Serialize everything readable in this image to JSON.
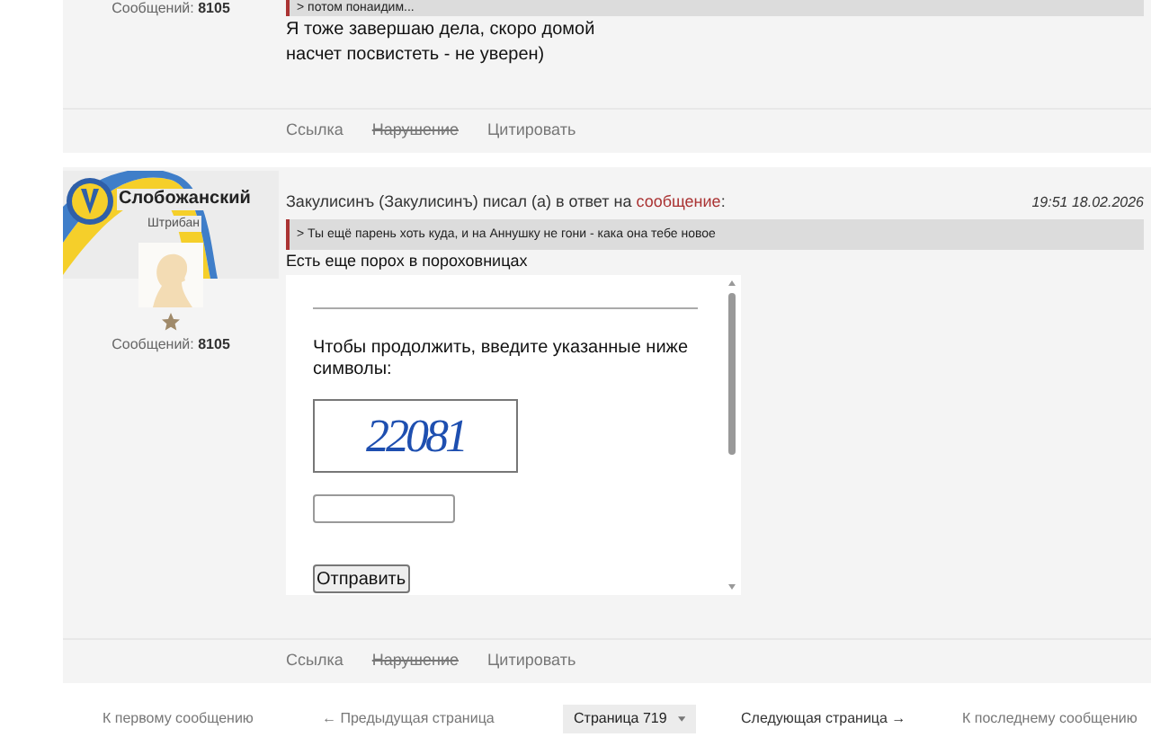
{
  "posts": [
    {
      "author": {
        "messages_label": "Сообщений:",
        "messages_count": "8105"
      },
      "quote": "> потом понаидим...",
      "body": [
        "Я тоже завершаю дела, скоро домой",
        "насчет посвистеть - не уверен)"
      ],
      "actions": [
        {
          "label": "Ссылка",
          "strikethrough": false
        },
        {
          "label": "Нарушение",
          "strikethrough": true
        },
        {
          "label": "Цитировать",
          "strikethrough": false
        }
      ]
    },
    {
      "author": {
        "name": "Слобожанский",
        "rank": "Штрибан",
        "messages_label": "Сообщений:",
        "messages_count": "8105"
      },
      "header": {
        "text": "Закулисинъ (Закулисинъ) писал (а) в ответ на",
        "link": "сообщение",
        "link_suffix": ":",
        "time": "19:51 18.02.2026"
      },
      "quote": "> Ты ещё парень хоть куда, и на Аннушку не гони - кака она тебе новое",
      "body": [
        "Есть еще порох в пороховницах"
      ],
      "embed": {
        "kind": "captcha",
        "prompt": "Чтобы продолжить, введите указанные ниже символы:",
        "code": "22081",
        "button": "Отправить"
      },
      "actions": [
        {
          "label": "Ссылка",
          "strikethrough": false
        },
        {
          "label": "Нарушение",
          "strikethrough": true
        },
        {
          "label": "Цитировать",
          "strikethrough": false
        }
      ]
    }
  ],
  "pagination": {
    "first": "К первому сообщению",
    "prev": "← Предыдущая страница",
    "page": "Страница 719",
    "next": "Следующая страница →",
    "last": "К последнему сообщению"
  }
}
